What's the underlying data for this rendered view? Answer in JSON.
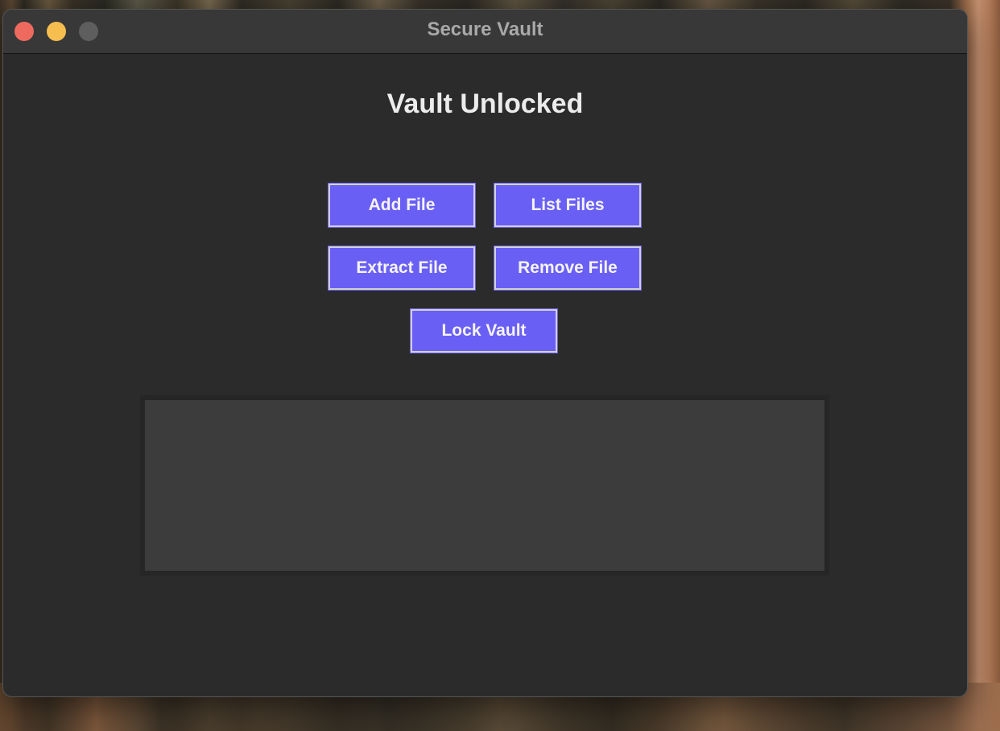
{
  "window": {
    "title": "Secure Vault"
  },
  "main": {
    "heading": "Vault Unlocked",
    "buttons": {
      "add_file": "Add File",
      "list_files": "List Files",
      "extract_file": "Extract File",
      "remove_file": "Remove File",
      "lock_vault": "Lock Vault"
    },
    "output_text": ""
  },
  "colors": {
    "button_bg": "#6a5ff5",
    "window_bg": "#2b2b2b",
    "output_bg": "#3c3c3c",
    "close": "#ee6a5f",
    "minimize": "#f5be4f",
    "zoom_disabled": "#5e5e5e"
  }
}
